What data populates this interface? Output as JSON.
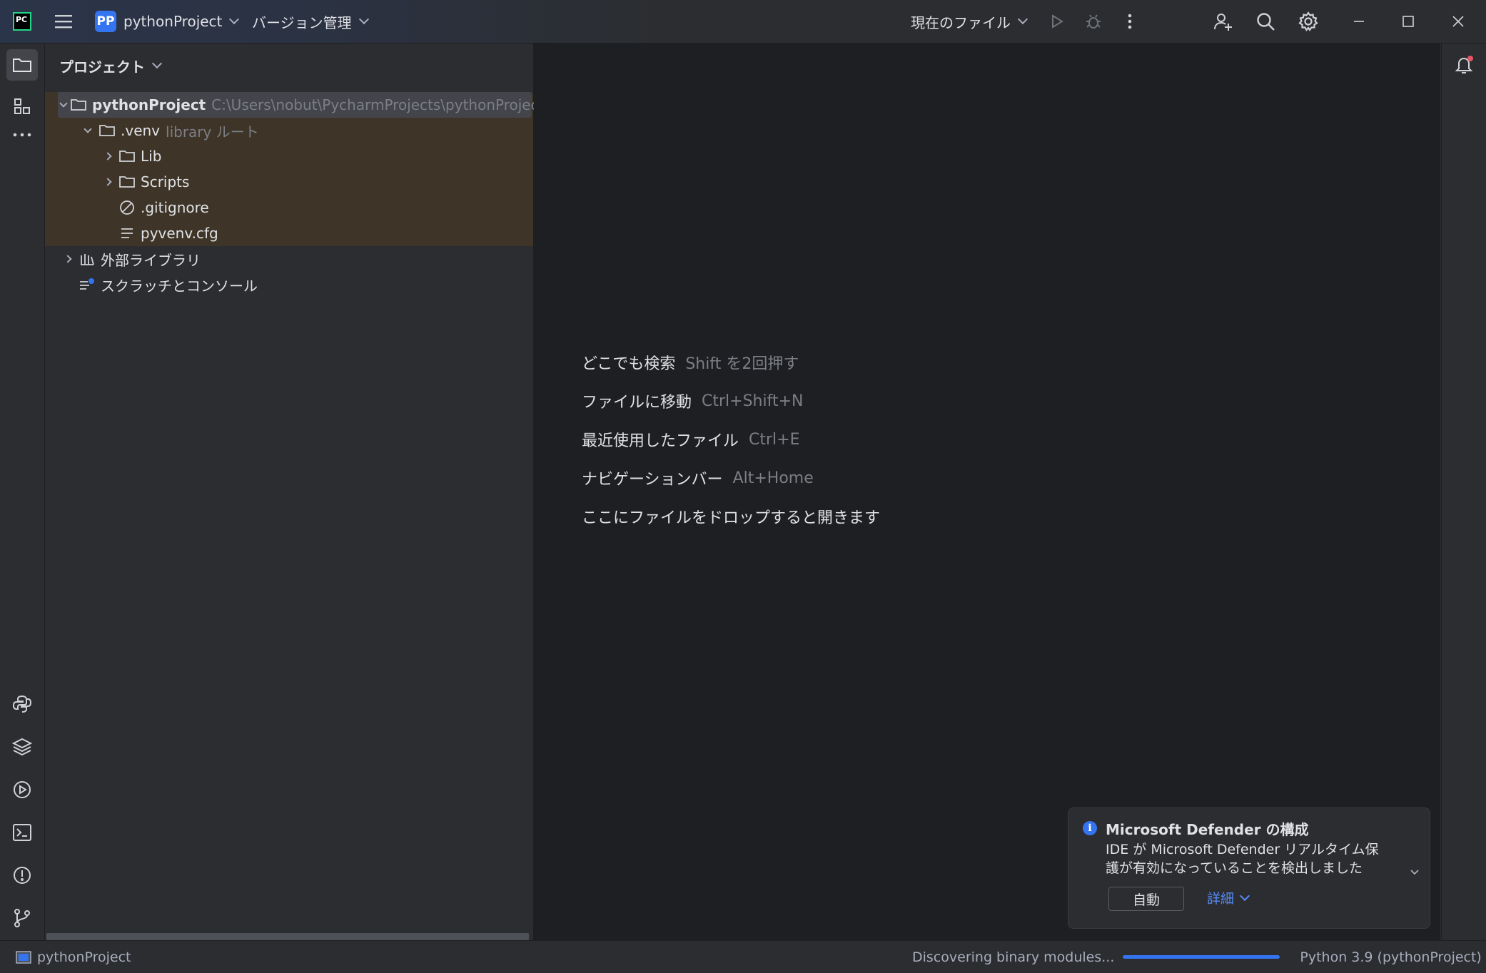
{
  "titlebar": {
    "project_badge": "PP",
    "project_name": "pythonProject",
    "vcs_label": "バージョン管理",
    "run_config": "現在のファイル"
  },
  "project_panel": {
    "title": "プロジェクト",
    "tree": {
      "root": {
        "name": "pythonProject",
        "path": "C:\\Users\\nobut\\PycharmProjects\\pythonProject"
      },
      "venv": {
        "name": ".venv",
        "hint": "library ルート"
      },
      "lib": "Lib",
      "scripts": "Scripts",
      "gitignore": ".gitignore",
      "pyvenv": "pyvenv.cfg",
      "external": "外部ライブラリ",
      "scratches": "スクラッチとコンソール"
    }
  },
  "editor": {
    "hints": [
      {
        "label": "どこでも検索",
        "shortcut": "Shift を2回押す"
      },
      {
        "label": "ファイルに移動",
        "shortcut": "Ctrl+Shift+N"
      },
      {
        "label": "最近使用したファイル",
        "shortcut": "Ctrl+E"
      },
      {
        "label": "ナビゲーションバー",
        "shortcut": "Alt+Home"
      },
      {
        "label": "ここにファイルをドロップすると開きます",
        "shortcut": ""
      }
    ]
  },
  "notification": {
    "title": "Microsoft Defender の構成",
    "body": "IDE が Microsoft Defender リアルタイム保護が有効になっていることを検出しました",
    "button": "自動",
    "link": "詳細"
  },
  "statusbar": {
    "project": "pythonProject",
    "task": "Discovering binary modules...",
    "progress": 1.0,
    "interpreter": "Python 3.9 (pythonProject)"
  },
  "colors": {
    "accent": "#3574f0",
    "venv_highlight": "#3e3528",
    "editor_bg": "#1e1f22",
    "panel_bg": "#2b2d30"
  }
}
